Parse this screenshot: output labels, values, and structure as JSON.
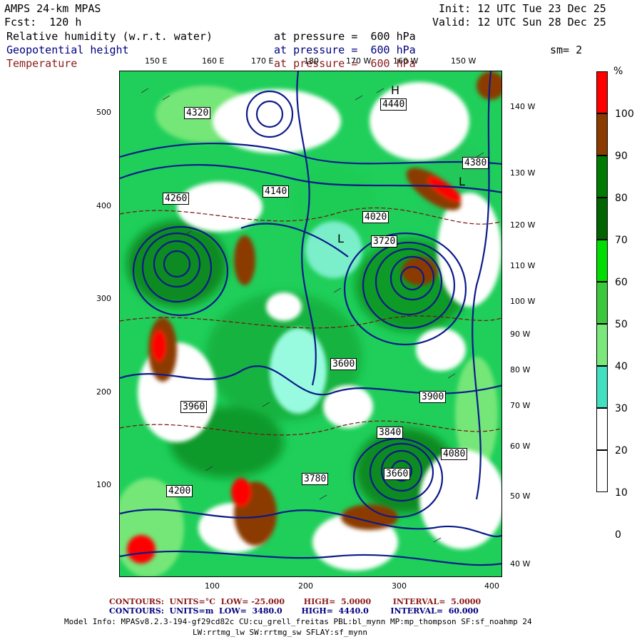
{
  "header": {
    "model": "AMPS 24-km MPAS",
    "forecast": "Fcst:  120 h",
    "init": "Init: 12 UTC Tue 23 Dec 25",
    "valid": "Valid: 12 UTC Sun 28 Dec 25",
    "smoothing": "sm= 2"
  },
  "fields": [
    {
      "name": "Relative humidity (w.r.t. water)",
      "level": "at pressure =  600 hPa",
      "color": "#000000"
    },
    {
      "name": "Geopotential height",
      "level": "at pressure =  600 hPa",
      "color": "#000080"
    },
    {
      "name": "Temperature",
      "level": "at pressure =  600 hPa",
      "color": "#8b1a1a"
    }
  ],
  "axes": {
    "x_ticks": [
      "100",
      "200",
      "300",
      "400"
    ],
    "y_ticks": [
      "500",
      "400",
      "300",
      "200",
      "100"
    ]
  },
  "geo_labels": {
    "top": [
      "150 E",
      "160 E",
      "170 E",
      "180",
      "170 W",
      "160 W",
      "150 W"
    ],
    "right": [
      "140 W",
      "130 W",
      "120 W",
      "110 W",
      "100 W",
      "90 W",
      "80 W",
      "70 W",
      "60 W",
      "50 W",
      "40 W"
    ]
  },
  "colorbar": {
    "unit": "%",
    "levels": [
      "100",
      "90",
      "80",
      "70",
      "60",
      "50",
      "40",
      "30",
      "20",
      "10",
      "0"
    ],
    "colors": [
      "#ff0000",
      "#8b3a00",
      "#007a00",
      "#006400",
      "#00dd00",
      "#3cc83c",
      "#7ae87a",
      "#40e0c0",
      "#ffffff",
      "#ffffff",
      "#ffffff"
    ]
  },
  "height_labels": [
    "4320",
    "4260",
    "4140",
    "4020",
    "3960",
    "3900",
    "3840",
    "3780",
    "3720",
    "4380",
    "4440",
    "4080",
    "4200",
    "3660",
    "3600"
  ],
  "footer": {
    "contours_temp": "CONTOURS:  UNITS=°C  LOW= -25.000       HIGH=  5.0000        INTERVAL=  5.0000",
    "contours_height": "CONTOURS:  UNITS=m  LOW=  3480.0       HIGH=  4440.0        INTERVAL=  60.000",
    "model_info": "Model Info: MPASv8.2.3-194-gf29cd82c CU:cu_grell_freitas PBL:bl_mynn MP:mp_thompson SF:sf_noahmp 24",
    "model_info2": "LW:rrtmg_lw SW:rrtmg_sw SFLAY:sf_mynn"
  }
}
